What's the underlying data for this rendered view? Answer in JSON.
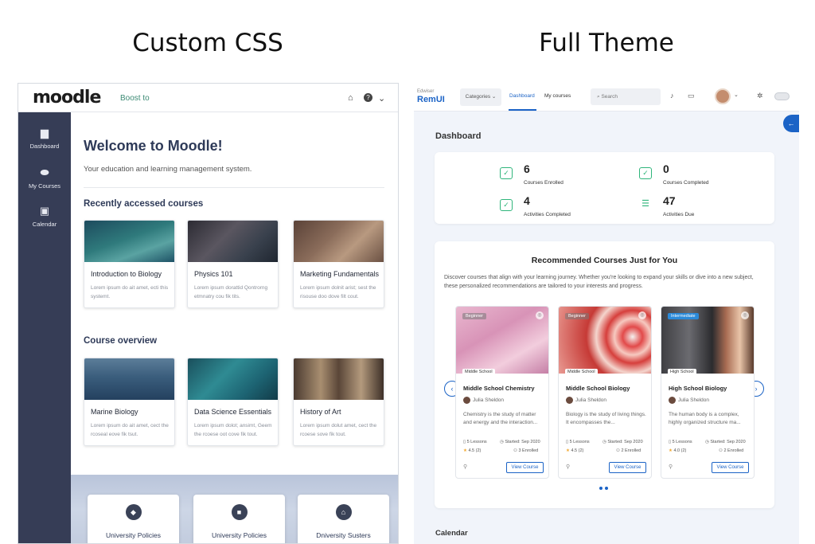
{
  "headings": {
    "left": "Custom CSS",
    "right": "Full Theme"
  },
  "left": {
    "logo": "moodle",
    "top_link": "Boost to",
    "sidebar": [
      {
        "icon": "dashboard-icon",
        "label": "Dashboard"
      },
      {
        "icon": "my-courses-icon",
        "label": "My Courses"
      },
      {
        "icon": "calendar-icon",
        "label": "Calendar"
      }
    ],
    "welcome_title": "Welcome to Moodle!",
    "welcome_sub": "Your education and learning management system.",
    "recent_heading": "Recently accessed courses",
    "recent": [
      {
        "title": "Introduction to Biology",
        "desc": "Lorem ipsum do ait amet, ecti this systemt."
      },
      {
        "title": "Physics 101",
        "desc": "Lorem ipsum dorattid Qontrorng etmnatry cou fik tits."
      },
      {
        "title": "Marketing Fundamentals",
        "desc": "Lorem ipsum dolnit arist; sest the risouse doo dove filt cout."
      }
    ],
    "overview_heading": "Course overview",
    "overview": [
      {
        "title": "Marine Biology",
        "desc": "Lorem ipsum do ait amet, cect the rcoseal eove fik tsut."
      },
      {
        "title": "Data Science Essentials",
        "desc": "Lorem ipsum dolot; ansimt, Geem the rcoese oot cove fik tout."
      },
      {
        "title": "History of Art",
        "desc": "Lorem ipsum dolut amet, cect the rcoese sove fik tout."
      }
    ],
    "policy_boxes": [
      "University Policies",
      "University Policies",
      "Dniversity Susters"
    ]
  },
  "right": {
    "logo_small": "Edwiser",
    "logo": "RemUI",
    "categories": "Categories",
    "nav_dashboard": "Dashboard",
    "nav_my_courses": "My courses",
    "search_placeholder": "Search",
    "dashboard_title": "Dashboard",
    "stats": [
      {
        "value": "6",
        "label": "Courses Enrolled"
      },
      {
        "value": "0",
        "label": "Courses Completed"
      },
      {
        "value": "4",
        "label": "Activities Completed"
      },
      {
        "value": "47",
        "label": "Activities Due"
      }
    ],
    "rec_title": "Recommended Courses Just for You",
    "rec_desc": "Discover courses that align with your learning journey. Whether you're looking to expand your skills or dive into a new subject, these personalized recommendations are tailored to your interests and progress.",
    "courses": [
      {
        "level": "Beginner",
        "category": "Middle School",
        "title": "Middle School Chemistry",
        "author": "Julia Sheldon",
        "desc": "Chemistry is the study of matter and energy and the interaction...",
        "lessons": "5 Lessons",
        "started": "Started: Sep 2020",
        "rating": "4.5 (2)",
        "enrolled": "3 Enrolled",
        "button": "View Course"
      },
      {
        "level": "Beginner",
        "category": "Middle School",
        "title": "Middle School Biology",
        "author": "Julia Sheldon",
        "desc": "Biology is the study of living things. It encompasses the...",
        "lessons": "5 Lessons",
        "started": "Started: Sep 2020",
        "rating": "4.5 (2)",
        "enrolled": "2 Enrolled",
        "button": "View Course"
      },
      {
        "level": "Intermediate",
        "category": "High School",
        "title": "High School Biology",
        "author": "Julia Sheldon",
        "desc": "The human body is a complex, highly organized structure ma...",
        "lessons": "5 Lessons",
        "started": "Started: Sep 2020",
        "rating": "4.0 (2)",
        "enrolled": "2 Enrolled",
        "button": "View Course"
      }
    ],
    "calendar_title": "Calendar"
  }
}
